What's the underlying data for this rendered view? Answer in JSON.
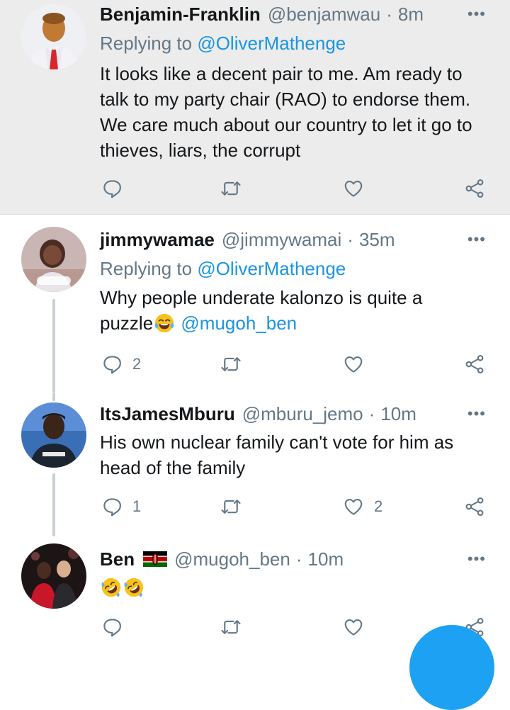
{
  "tweets": [
    {
      "name": "Benjamin-Franklin",
      "handle": "@benjamwau",
      "sep": "·",
      "time": "8m",
      "more": "•••",
      "replying_prefix": "Replying to ",
      "replying_to": "@OliverMathenge",
      "text": "It looks like a decent pair to me. Am ready to talk to my party chair (RAO) to endorse them. We care much about our country to let it go to thieves, liars, the corrupt",
      "reply_count": "",
      "retweet_count": "",
      "like_count": ""
    },
    {
      "name": "jimmywamae",
      "handle": "@jimmywamai",
      "sep": "·",
      "time": "35m",
      "more": "•••",
      "replying_prefix": "Replying to ",
      "replying_to": "@OliverMathenge",
      "text_before": "Why people underate kalonzo is quite a puzzle",
      "text_mention": "@mugoh_ben",
      "reply_count": "2",
      "retweet_count": "",
      "like_count": ""
    },
    {
      "name": "ItsJamesMburu",
      "handle": "@mburu_jemo",
      "sep": "·",
      "time": "10m",
      "more": "•••",
      "text": "His own nuclear family can't vote for him as head of the family",
      "reply_count": "1",
      "retweet_count": "",
      "like_count": "2"
    },
    {
      "name": "Ben",
      "handle": "@mugoh_ben",
      "sep": "·",
      "time": "10m",
      "more": "•••",
      "reply_count": "",
      "retweet_count": "",
      "like_count": ""
    }
  ],
  "icons": {
    "reply": "reply-icon",
    "retweet": "retweet-icon",
    "like": "heart-icon",
    "share": "share-icon",
    "laugh_emoji": "face-with-tears-of-joy",
    "rofl_emoji": "rolling-on-floor-laughing",
    "flag": "kenya-flag"
  },
  "colors": {
    "link": "#1b95e0",
    "secondary_text": "#657786",
    "highlight_bg": "#ececec",
    "fab": "#1da1f2"
  }
}
